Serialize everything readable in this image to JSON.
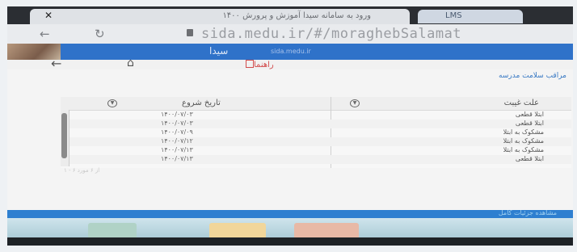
{
  "browser": {
    "active_tab_title": "ورود به سامانه سیدا آموزش و پرورش ۱۴۰۰",
    "active_tab_close": "✕",
    "other_tab_title": "LMS",
    "url": "sida.medu.ir/#/moraghebSalamat",
    "back_icon": "←",
    "reload_icon": "↻"
  },
  "site_header": {
    "logo_text": "سیدا",
    "subtitle": "sida.medu.ir"
  },
  "nav": {
    "back_icon": "←",
    "home_icon": "⌂",
    "guide_label": "راهنما"
  },
  "section_title": "مراقب سلامت مدرسه",
  "table": {
    "columns": [
      {
        "label": "علت غیبت",
        "sort_icon": "▼"
      },
      {
        "label": "تاریخ شروع",
        "sort_icon": "▼"
      }
    ],
    "rows": [
      {
        "reason": "ابتلا قطعی",
        "date": "۱۴۰۰/۰۷/۰۳"
      },
      {
        "reason": "ابتلا قطعی",
        "date": "۱۴۰۰/۰۷/۰۳"
      },
      {
        "reason": "مشکوک به ابتلا",
        "date": "۱۴۰۰/۰۷/۰۹"
      },
      {
        "reason": "مشکوک به ابتلا",
        "date": "۱۴۰۰/۰۷/۱۲"
      },
      {
        "reason": "مشکوک به ابتلا",
        "date": "۱۴۰۰/۰۷/۱۳"
      },
      {
        "reason": "ابتلا قطعی",
        "date": "۱۴۰۰/۰۷/۱۳"
      }
    ],
    "footer": "۱ - ۶ از ۶ مورد"
  },
  "status_bar": {
    "text": "مشاهده جزئیات کامل"
  },
  "colors": {
    "header_blue": "#2f72c9",
    "guide_red": "#d24c4c",
    "title_blue": "#3a7ac4"
  }
}
